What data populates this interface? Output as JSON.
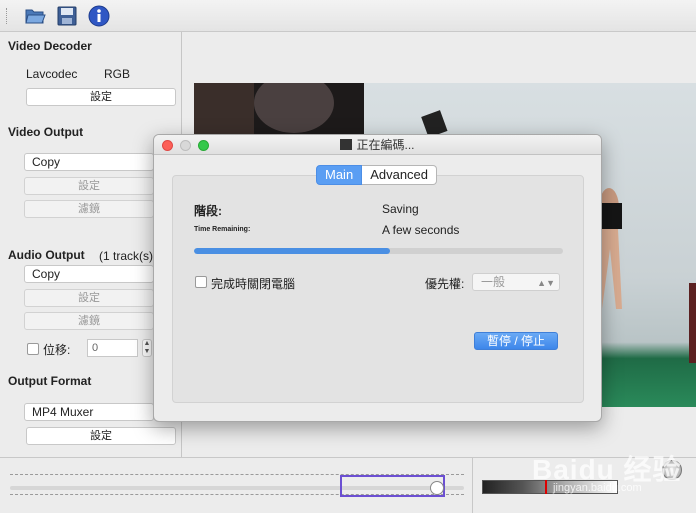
{
  "toolbar": {
    "icons": [
      "open-folder-icon",
      "save-disk-icon",
      "info-icon"
    ]
  },
  "video_decoder": {
    "title": "Video Decoder",
    "decoder": "Lavcodec",
    "format": "RGB",
    "settings_label": "設定"
  },
  "video_output": {
    "title": "Video Output",
    "codec": "Copy",
    "settings_label": "設定",
    "filters_label": "濾鏡"
  },
  "audio_output": {
    "title": "Audio Output",
    "tracks": "(1 track(s)",
    "codec": "Copy",
    "settings_label": "設定",
    "filters_label": "濾鏡",
    "shift_label": "位移:",
    "shift_value": "0"
  },
  "output_format": {
    "title": "Output Format",
    "muxer": "MP4 Muxer",
    "settings_label": "設定"
  },
  "dialog": {
    "title": "正在編碼...",
    "tabs": [
      {
        "label": "Main",
        "active": true
      },
      {
        "label": "Advanced",
        "active": false
      }
    ],
    "stage_label": "階段:",
    "stage_value": "Saving",
    "time_label": "Time Remaining:",
    "time_value": "A few seconds",
    "progress": 0.53,
    "shutdown_label": "完成時關閉電腦",
    "priority_label": "優先權:",
    "priority_value": "一般",
    "pause_label": "暫停 / 停止"
  },
  "watermark": {
    "main": "Baidu 经验",
    "sub": "jingyan.baidu.com"
  },
  "colors": {
    "accent": "#4a8fe3",
    "close": "#fc5f57",
    "zoom": "#34c84a"
  }
}
